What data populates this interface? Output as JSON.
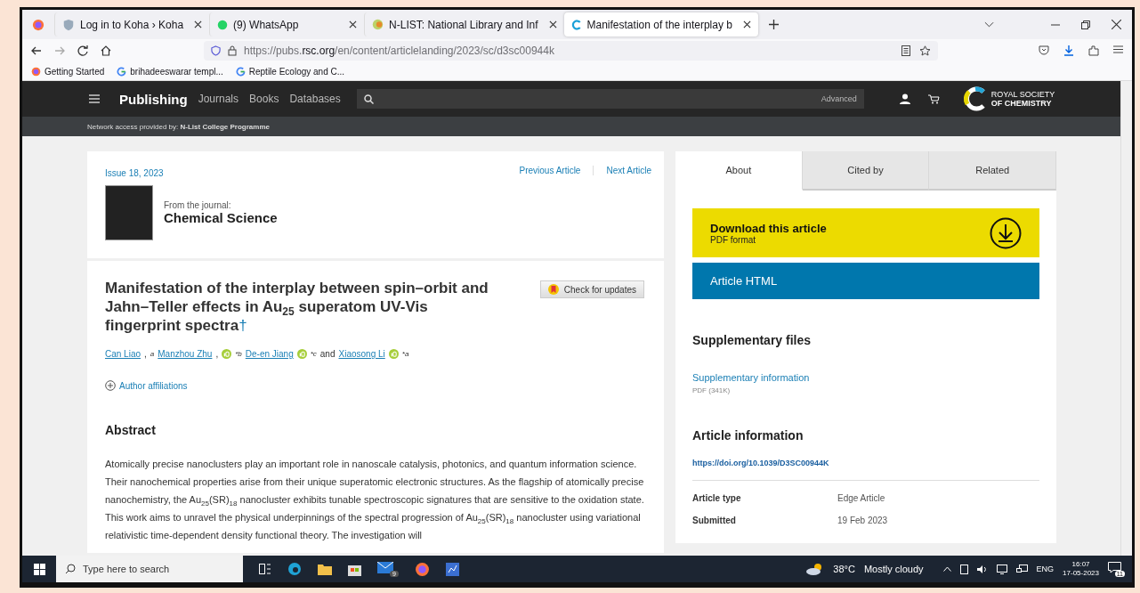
{
  "browser": {
    "tabs": [
      {
        "title": "Log in to Koha › Koha",
        "selected": false
      },
      {
        "title": "(9) WhatsApp",
        "selected": false
      },
      {
        "title": "N-LIST: National Library and Inf",
        "selected": false
      },
      {
        "title": "Manifestation of the interplay b",
        "selected": true
      }
    ],
    "url": {
      "prefix": "https://pubs.",
      "domain": "rsc.org",
      "path": "/en/content/articlelanding/2023/sc/d3sc00944k"
    },
    "bookmarks": [
      "Getting Started",
      "brihadeeswarar templ...",
      "Reptile Ecology and C..."
    ]
  },
  "site": {
    "brand": "Publishing",
    "nav": [
      "Journals",
      "Books",
      "Databases"
    ],
    "advanced": "Advanced",
    "logo_lines": [
      "ROYAL SOCIETY",
      "OF CHEMISTRY"
    ],
    "network_access": "Network access provided by: **N-List College Programme**"
  },
  "article": {
    "issue": "Issue 18, 2023",
    "previous": "Previous Article",
    "next": "Next Article",
    "journal_label": "From the journal:",
    "journal": "Chemical Science",
    "title": "Manifestation of the interplay between spin–orbit and Jahn–Teller effects in Au$_{25}$ superatom UV-Vis fingerprint spectra",
    "title_mark": "†",
    "check_updates": "Check for updates",
    "authors": [
      {
        "name": "Can Liao",
        "suffix": ",",
        "orcid": false,
        "marks": "a"
      },
      {
        "name": "Manzhou Zhu",
        "suffix": ",",
        "orcid": true,
        "marks": "*b"
      },
      {
        "name": "De-en Jiang",
        "orcid": true,
        "marks": "*c"
      },
      {
        "name": "Xiaosong Li",
        "orcid": true,
        "marks": "*a"
      }
    ],
    "authors_joiner": "and",
    "affiliations": "Author affiliations",
    "abstract_heading": "Abstract",
    "abstract": "Atomically precise nanoclusters play an important role in nanoscale catalysis, photonics, and quantum information science. Their nanochemical properties arise from their unique superatomic electronic structures. As the flagship of atomically precise nanochemistry, the Au$_{25}$(SR)$_{18}$ nanocluster exhibits tunable spectroscopic signatures that are sensitive to the oxidation state. This work aims to unravel the physical underpinnings of the spectral progression of Au$_{25}$(SR)$_{18}$ nanocluster using variational relativistic time-dependent density functional theory. The investigation will"
  },
  "sidebar": {
    "tabs": [
      {
        "label": "About",
        "selected": true
      },
      {
        "label": "Cited by",
        "selected": false
      },
      {
        "label": "Related",
        "selected": false
      }
    ],
    "download": {
      "title": "Download this article",
      "subtitle": "PDF format"
    },
    "html_button": "Article HTML",
    "supplementary": {
      "heading": "Supplementary files",
      "link": "Supplementary information",
      "size": "PDF (341K)"
    },
    "article_info": {
      "heading": "Article information",
      "doi": "https://doi.org/10.1039/D3SC00944K",
      "rows": [
        {
          "label": "Article type",
          "value": "Edge Article"
        },
        {
          "label": "Submitted",
          "value": "19 Feb 2023"
        }
      ]
    }
  },
  "taskbar": {
    "search_placeholder": "Type here to search",
    "temperature": "38°C",
    "weather": "Mostly cloudy",
    "language": "ENG",
    "time": "16:07",
    "date": "17-05-2023",
    "notifications": "11",
    "mail_badge": "9"
  }
}
